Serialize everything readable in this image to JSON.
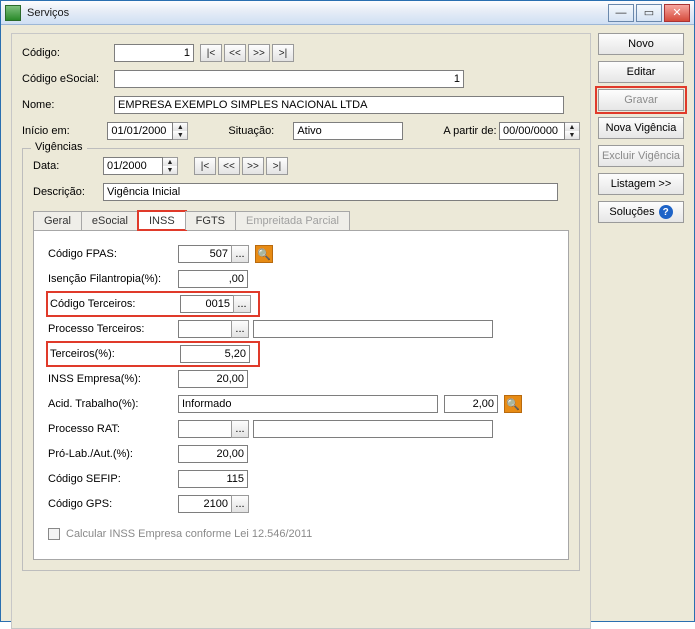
{
  "window": {
    "title": "Serviços"
  },
  "sidebar": {
    "novo": "Novo",
    "editar": "Editar",
    "gravar": "Gravar",
    "nova_vigencia": "Nova Vigência",
    "excluir_vigencia": "Excluir Vigência",
    "listagem": "Listagem >>",
    "solucoes": "Soluções"
  },
  "header": {
    "codigo_label": "Código:",
    "codigo_value": "1",
    "codigo_esocial_label": "Código eSocial:",
    "codigo_esocial_value": "1",
    "nome_label": "Nome:",
    "nome_value": "EMPRESA EXEMPLO SIMPLES NACIONAL LTDA",
    "inicio_label": "Início em:",
    "inicio_value": "01/01/2000",
    "situacao_label": "Situação:",
    "situacao_value": "Ativo",
    "apartir_label": "A partir de:",
    "apartir_value": "00/00/0000"
  },
  "vigencias": {
    "legend": "Vigências",
    "data_label": "Data:",
    "data_value": "01/2000",
    "descricao_label": "Descrição:",
    "descricao_value": "Vigência Inicial"
  },
  "nav": {
    "first": "|<",
    "prev": "<<",
    "next": ">>",
    "last": ">|"
  },
  "tabs": {
    "geral": "Geral",
    "esocial": "eSocial",
    "inss": "INSS",
    "fgts": "FGTS",
    "empreitada": "Empreitada Parcial"
  },
  "inss": {
    "codigo_fpas_label": "Código FPAS:",
    "codigo_fpas_value": "507",
    "isencao_label": "Isenção Filantropia(%):",
    "isencao_value": ",00",
    "codigo_terc_label": "Código Terceiros:",
    "codigo_terc_value": "0015",
    "processo_terc_label": "Processo Terceiros:",
    "processo_terc_value": "",
    "terc_pct_label": "Terceiros(%):",
    "terc_pct_value": "5,20",
    "inss_emp_label": "INSS Empresa(%):",
    "inss_emp_value": "20,00",
    "acid_label": "Acid. Trabalho(%):",
    "acid_text": "Informado",
    "acid_value": "2,00",
    "processo_rat_label": "Processo RAT:",
    "processo_rat_value": "",
    "prolab_label": "Pró-Lab./Aut.(%):",
    "prolab_value": "20,00",
    "sefip_label": "Código SEFIP:",
    "sefip_value": "115",
    "gps_label": "Código GPS:",
    "gps_value": "2100",
    "calc_checkbox_label": "Calcular INSS Empresa conforme Lei 12.546/2011"
  },
  "glyph": {
    "dots": "...",
    "doc": "🔍",
    "up": "▲",
    "down": "▼",
    "help": "?"
  }
}
